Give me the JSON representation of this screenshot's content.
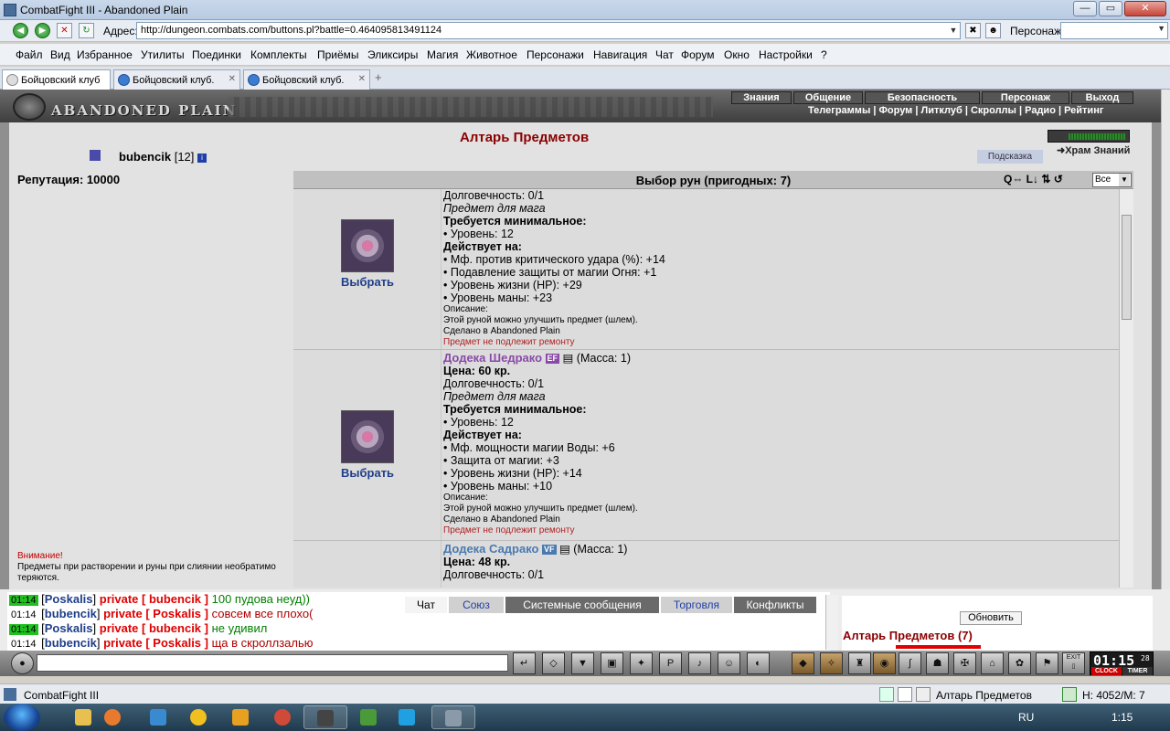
{
  "window": {
    "title": "CombatFight III - Abandoned Plain",
    "btn_min": "—",
    "btn_max": "▭",
    "btn_close": "✕"
  },
  "addressbar": {
    "label": "Адрес:",
    "url": "http://dungeon.combats.com/buttons.pl?battle=0.464095813491124",
    "person_label": "Персонаж:"
  },
  "menu": [
    "Файл",
    "Вид",
    "Избранное",
    "Утилиты",
    "Поединки",
    "Комплекты",
    "Приёмы",
    "Эликсиры",
    "Магия",
    "Животное",
    "Персонажи",
    "Навигация",
    "Чат",
    "Форум",
    "Окно",
    "Настройки",
    "?"
  ],
  "tabs": [
    "Бойцовский клуб",
    "Бойцовский клуб.",
    "Бойцовский клуб."
  ],
  "tab_add": "+",
  "game": {
    "logo_text": "ABANDONED PLAIN",
    "topnav": [
      "Знания",
      "Общение",
      "Безопасность",
      "Персонаж",
      "Выход"
    ],
    "subnav": "Телеграммы | Форум | Литклуб | Скроллы | Радио | Рейтинг",
    "page_title": "Алтарь Предметов",
    "hram_link": "Храм Знаний",
    "hint_button": "Подсказка",
    "user_nick": "bubencik",
    "user_level": "[12]",
    "reputation": "Репутация: 10000",
    "warning_title": "Внимание!",
    "warning_text": "Предметы при растворении и руны при слиянии необратимо теряются."
  },
  "runes": {
    "header": "Выбор рун (пригодных: 7)",
    "tools": "Q⇔ L↓ ⇅ ↺",
    "filter_value": "Все",
    "select_label": "Выбрать",
    "items": [
      {
        "name": "",
        "lines": [
          {
            "t": "Долговечность: 0/1",
            "c": ""
          },
          {
            "t": "Предмет для мага",
            "c": "i"
          },
          {
            "t": "Требуется минимальное:",
            "c": "b"
          },
          {
            "t": "• Уровень: 12",
            "c": ""
          },
          {
            "t": "Действует на:",
            "c": "b"
          },
          {
            "t": "• Мф. против критического удара (%): +14",
            "c": ""
          },
          {
            "t": "• Подавление защиты от магии Огня: +1",
            "c": ""
          },
          {
            "t": "• Уровень жизни (HP): +29",
            "c": ""
          },
          {
            "t": "• Уровень маны: +23",
            "c": ""
          },
          {
            "t": "Описание:",
            "c": "sm"
          },
          {
            "t": "Этой руной можно улучшить предмет (шлем).",
            "c": "sm"
          },
          {
            "t": "Сделано в Abandoned Plain",
            "c": "sm"
          },
          {
            "t": "Предмет не подлежит ремонту",
            "c": "red"
          }
        ]
      },
      {
        "name": "Додека Шедрако",
        "tag": "EF",
        "mass": "(Масса: 1)",
        "lines": [
          {
            "t": "Цена: 60 кр.",
            "c": "b"
          },
          {
            "t": "Долговечность: 0/1",
            "c": ""
          },
          {
            "t": "Предмет для мага",
            "c": "i"
          },
          {
            "t": "Требуется минимальное:",
            "c": "b"
          },
          {
            "t": "• Уровень: 12",
            "c": ""
          },
          {
            "t": "Действует на:",
            "c": "b"
          },
          {
            "t": "• Мф. мощности магии Воды: +6",
            "c": ""
          },
          {
            "t": "• Защита от магии: +3",
            "c": ""
          },
          {
            "t": "• Уровень жизни (HP): +14",
            "c": ""
          },
          {
            "t": "• Уровень маны: +10",
            "c": ""
          },
          {
            "t": "Описание:",
            "c": "sm"
          },
          {
            "t": "Этой руной можно улучшить предмет (шлем).",
            "c": "sm"
          },
          {
            "t": "Сделано в Abandoned Plain",
            "c": "sm"
          },
          {
            "t": "Предмет не подлежит ремонту",
            "c": "red"
          }
        ]
      },
      {
        "name": "Додека Садрако",
        "tag": "VF",
        "mass": "(Масса: 1)",
        "lines": [
          {
            "t": "Цена: 48 кр.",
            "c": "b"
          },
          {
            "t": "Долговечность: 0/1",
            "c": ""
          }
        ]
      }
    ]
  },
  "chat": {
    "lines": [
      {
        "time": "01:14",
        "from": "Poskalis",
        "to": "bubencik",
        "msg": "100 пудова неуд))",
        "self": false
      },
      {
        "time": "01:14",
        "from": "bubencik",
        "to": "Poskalis",
        "msg": "совсем все плохо(",
        "self": true
      },
      {
        "time": "01:14",
        "from": "Poskalis",
        "to": "bubencik",
        "msg": "не удивил",
        "self": false
      },
      {
        "time": "01:14",
        "from": "bubencik",
        "to": "Poskalis",
        "msg": "ща в скроллзалью",
        "self": true
      }
    ],
    "private_word": "private",
    "tabs": [
      "Чат",
      "Союз",
      "Системные сообщения",
      "Торговля",
      "Конфликты"
    ],
    "refresh": "Обновить",
    "panel_title": "Алтарь Предметов (7)"
  },
  "clock": {
    "time": "01:15",
    "seconds": "28",
    "label_clock": "CLOCK",
    "label_timer": "TIMER"
  },
  "toolbar_exit": "EXIT",
  "statusbar": {
    "left": "CombatFight III",
    "mid": "Алтарь Предметов",
    "right": "H: 4052/M: 7"
  },
  "taskbar": {
    "lang": "RU",
    "time": "1:15"
  },
  "colors": {
    "accent_red": "#8b0000",
    "link_blue": "#1f3f8a",
    "rune_name": "#8a4aa8"
  }
}
